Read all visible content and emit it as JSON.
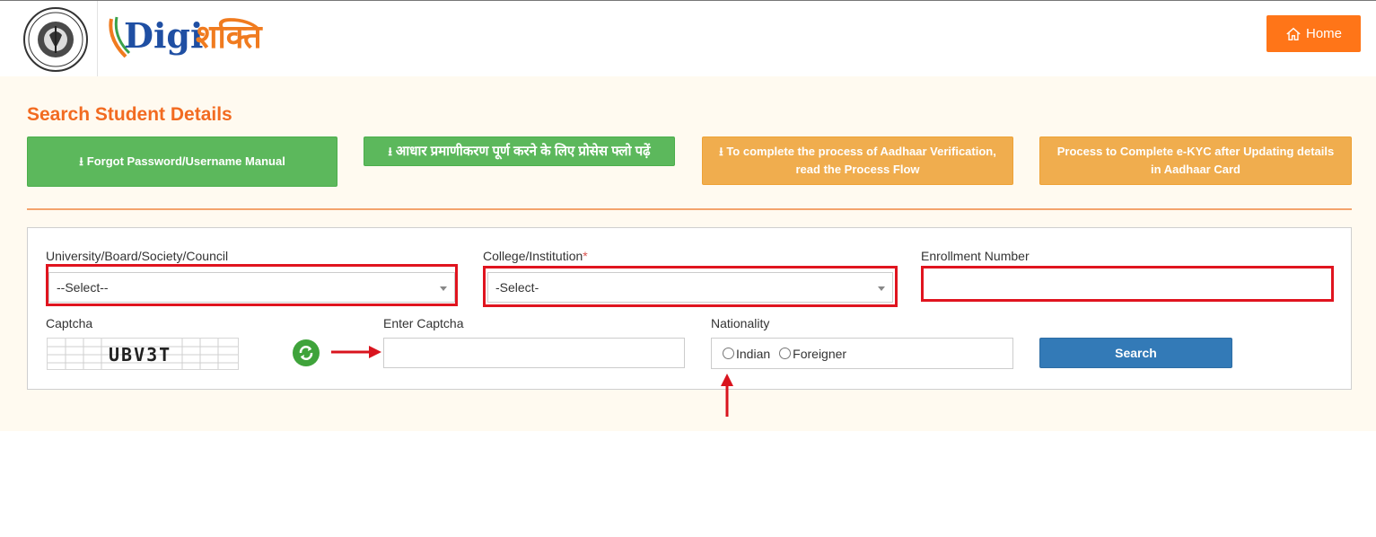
{
  "header": {
    "logo_latin": "Digi",
    "logo_deva": "शक्ति",
    "home_label": "Home"
  },
  "page": {
    "title": "Search Student Details"
  },
  "actions": {
    "forgot_manual": "Forgot Password/Username Manual",
    "aadhaar_hindi": "आधार प्रमाणीकरण पूर्ण करने के लिए प्रोसेस फ्लो पढ़ें",
    "aadhaar_english": "To complete the process of Aadhaar Verification, read the Process Flow",
    "ekyc": "Process to Complete e-KYC after Updating details in Aadhaar Card"
  },
  "form": {
    "university_label": "University/Board/Society/Council",
    "university_value": "--Select--",
    "college_label": "College/Institution",
    "college_required": "*",
    "college_value": "-Select-",
    "enrollment_label": "Enrollment Number",
    "enrollment_value": "",
    "captcha_label": "Captcha",
    "captcha_text": "UBV3T",
    "enter_captcha_label": "Enter Captcha",
    "enter_captcha_value": "",
    "nationality_label": "Nationality",
    "nationality_options": [
      "Indian",
      "Foreigner"
    ],
    "search_label": "Search"
  },
  "colors": {
    "brand_orange": "#f26b21",
    "home_orange": "#ff7518",
    "green": "#5cb85c",
    "amber": "#f0ad4e",
    "search_blue": "#337ab7",
    "highlight_red": "#e0141f",
    "panel_bg": "#fffaf0"
  },
  "icons": [
    "emblem-icon",
    "home-icon",
    "download-icon",
    "refresh-icon"
  ]
}
